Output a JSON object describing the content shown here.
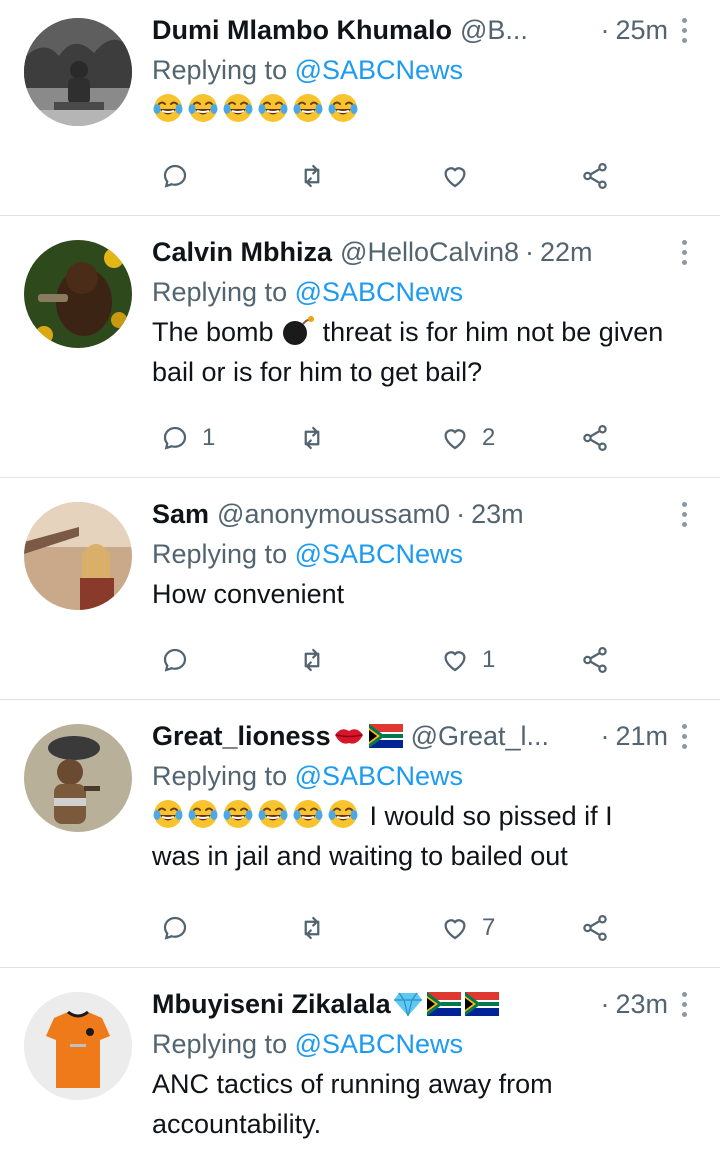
{
  "tweets": [
    {
      "name": "Dumi Mlambo Khumalo",
      "handle": "@B...",
      "time": "25m",
      "reply_prefix": "Replying to ",
      "reply_to": "@SABCNews",
      "text": "",
      "replies": "",
      "likes": "",
      "emojis": 6
    },
    {
      "name": "Calvin Mbhiza",
      "handle": "@HelloCalvin8",
      "time": "22m",
      "reply_prefix": "Replying to ",
      "reply_to": "@SABCNews",
      "text_part1": "The bomb",
      "text_part2": " threat is for him not be given bail or is for him to get bail?",
      "replies": "1",
      "likes": "2"
    },
    {
      "name": "Sam",
      "handle": "@anonymoussam0",
      "time": "23m",
      "reply_prefix": "Replying to ",
      "reply_to": "@SABCNews",
      "text": "How convenient",
      "replies": "",
      "likes": "1"
    },
    {
      "name": "Great_lioness",
      "handle": "@Great_l...",
      "time": "21m",
      "reply_prefix": "Replying to ",
      "reply_to": "@SABCNews",
      "text": " I would so pissed if I was in jail and waiting to bailed out",
      "replies": "",
      "likes": "7",
      "emojis": 6
    },
    {
      "name": "Mbuyiseni Zikalala",
      "handle": "",
      "time": "23m",
      "reply_prefix": "Replying to ",
      "reply_to": "@SABCNews",
      "text": "ANC tactics of running away from accountability."
    }
  ],
  "colors": {
    "link": "#1d9bf0",
    "muted": "#536471",
    "divider": "#dfe3e6"
  }
}
